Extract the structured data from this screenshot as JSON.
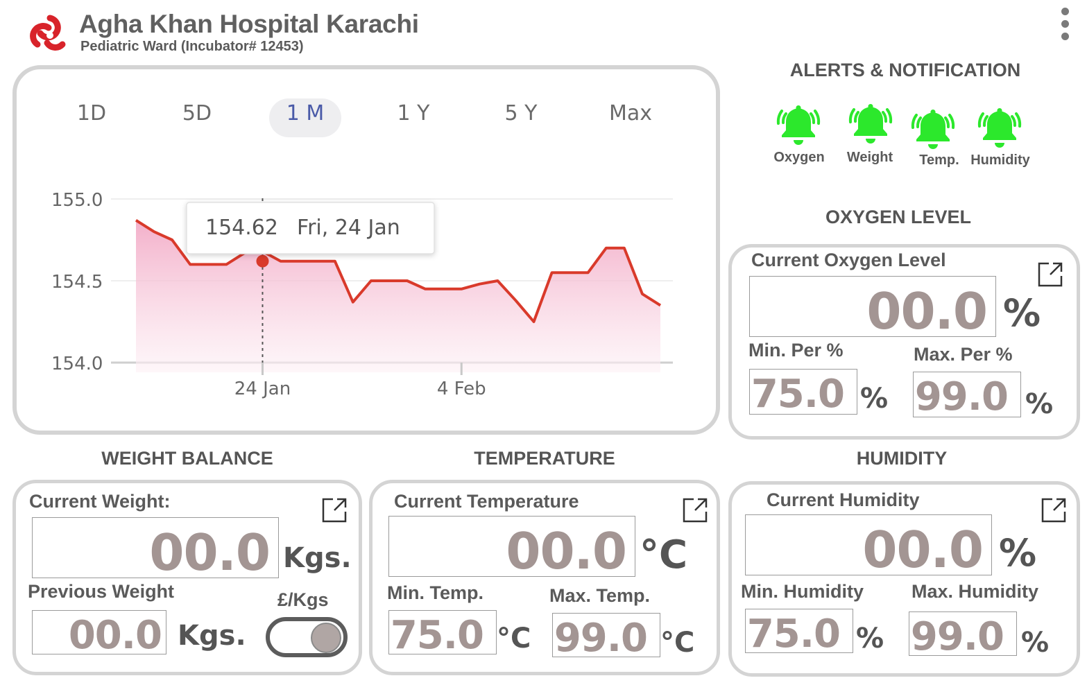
{
  "header": {
    "title": "Agha Khan Hospital Karachi",
    "subtitle": "Pediatric Ward (Incubator# 12453)"
  },
  "chart": {
    "ranges": [
      "1D",
      "5D",
      "1 M",
      "1 Y",
      "5 Y",
      "Max"
    ],
    "active_range": "1 M",
    "tooltip": {
      "value": "154.62",
      "date": "Fri, 24 Jan"
    },
    "colors": {
      "line": "#d93a2b",
      "fill_top": "#f2a7c4",
      "fill_bottom": "#fdf0f5"
    }
  },
  "chart_data": {
    "type": "area",
    "title": "",
    "xlabel": "",
    "ylabel": "",
    "ylim": [
      154.0,
      155.0
    ],
    "yticks": [
      "155.0",
      "154.5",
      "154.0"
    ],
    "xticks": [
      "24 Jan",
      "4 Feb"
    ],
    "x": [
      "16 Jan",
      "17 Jan",
      "19 Jan",
      "20 Jan",
      "21 Jan",
      "22 Jan",
      "23 Jan",
      "24 Jan",
      "25 Jan",
      "26 Jan",
      "27 Jan",
      "28 Jan",
      "29 Jan",
      "30 Jan",
      "31 Jan",
      "1 Feb",
      "2 Feb",
      "3 Feb",
      "4 Feb",
      "5 Feb",
      "6 Feb",
      "7 Feb",
      "8 Feb",
      "9 Feb",
      "10 Feb",
      "11 Feb",
      "12 Feb",
      "13 Feb",
      "14 Feb",
      "15 Feb"
    ],
    "values": [
      154.87,
      154.8,
      154.75,
      154.6,
      154.6,
      154.6,
      154.67,
      154.68,
      154.62,
      154.62,
      154.62,
      154.62,
      154.37,
      154.5,
      154.5,
      154.5,
      154.45,
      154.45,
      154.45,
      154.48,
      154.5,
      154.38,
      154.25,
      154.55,
      154.55,
      154.55,
      154.7,
      154.7,
      154.42,
      154.35
    ],
    "highlight": {
      "x": "24 Jan",
      "y": 154.62
    }
  },
  "alerts": {
    "title": "ALERTS & NOTIFICATION",
    "color": "#2ce82c",
    "items": [
      {
        "label": "Oxygen",
        "icon": "bell-ringing-icon"
      },
      {
        "label": "Weight",
        "icon": "bell-ringing-icon"
      },
      {
        "label": "Temp.",
        "icon": "bell-ringing-icon"
      },
      {
        "label": "Humidity",
        "icon": "bell-ringing-icon"
      }
    ]
  },
  "oxygen": {
    "section_title": "OXYGEN LEVEL",
    "current_label": "Current Oxygen Level",
    "current_value": "00.0",
    "unit": "%",
    "min_label": "Min. Per %",
    "min_value": "75.0",
    "max_label": "Max. Per %",
    "max_value": "99.0"
  },
  "weight": {
    "section_title": "WEIGHT BALANCE",
    "current_label": "Current Weight:",
    "current_value": "00.0",
    "unit": "Kgs.",
    "previous_label": "Previous Weight",
    "previous_value": "00.0",
    "toggle_label": "£/Kgs"
  },
  "temperature": {
    "section_title": "TEMPERATURE",
    "current_label": "Current Temperature",
    "current_value": "00.0",
    "unit": "°C",
    "min_label": "Min. Temp.",
    "min_value": "75.0",
    "max_label": "Max. Temp.",
    "max_value": "99.0"
  },
  "humidity": {
    "section_title": "HUMIDITY",
    "current_label": "Current Humidity",
    "current_value": "00.0",
    "unit": "%",
    "min_label": "Min. Humidity",
    "min_value": "75.0",
    "max_label": "Max. Humidity",
    "max_value": "99.0"
  }
}
